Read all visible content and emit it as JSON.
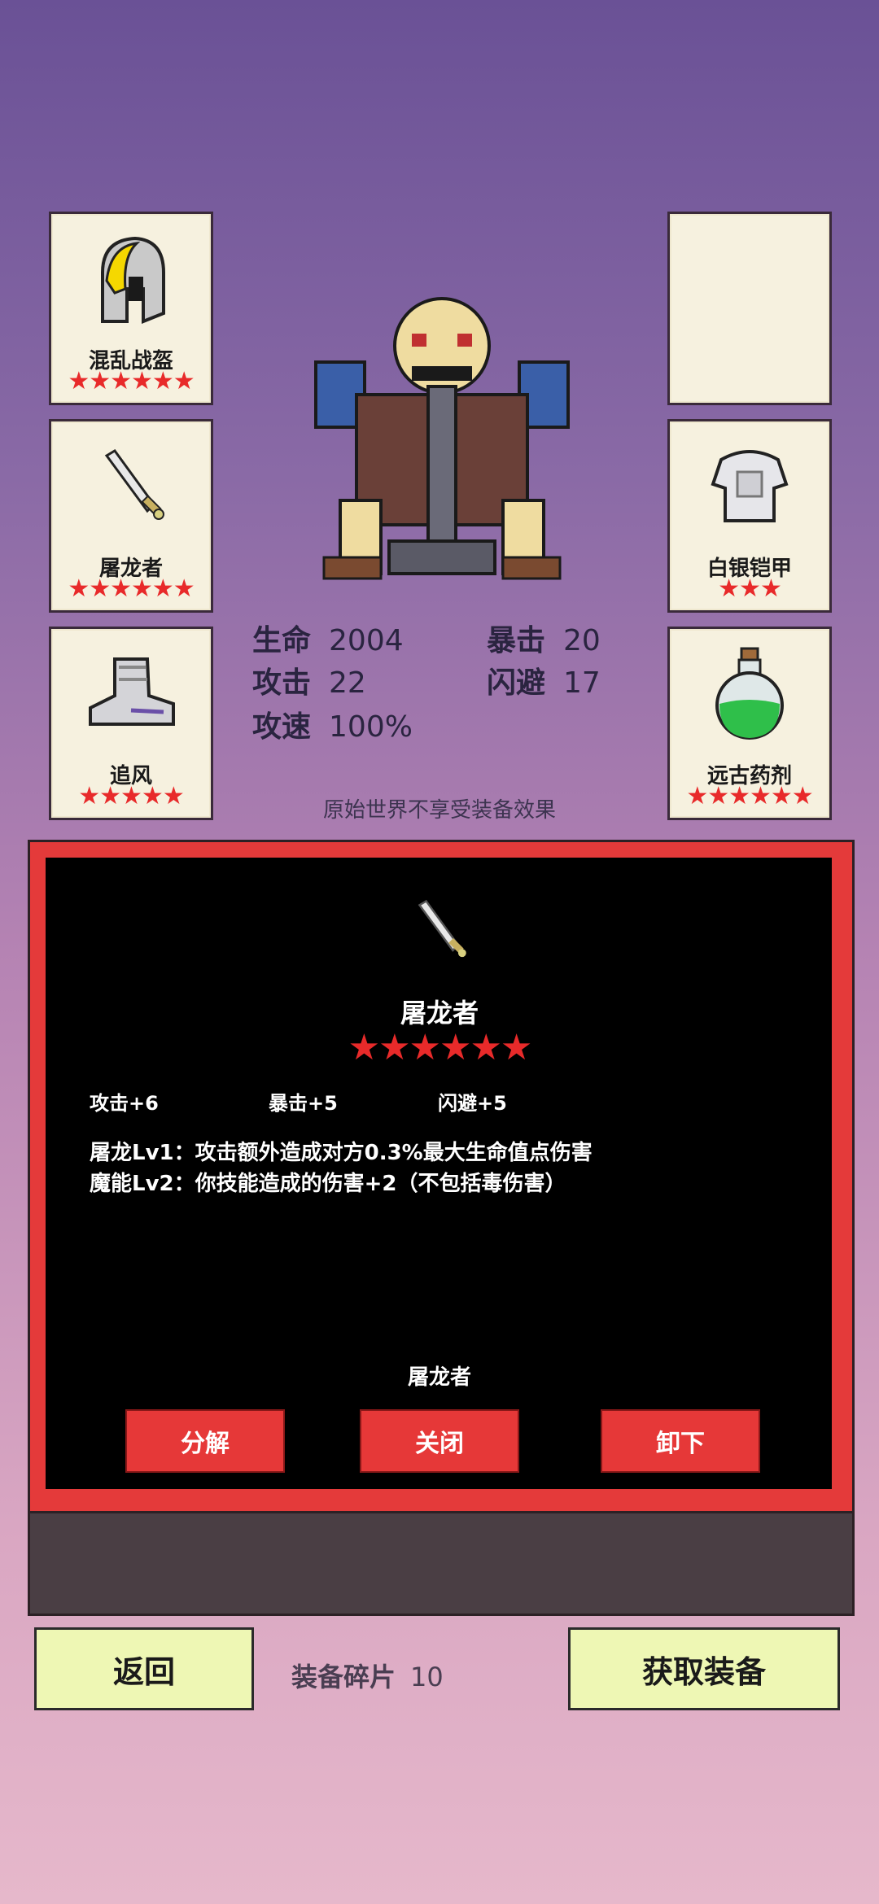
{
  "slots": {
    "helmet": {
      "name": "混乱战盔",
      "stars": "★★★★★★"
    },
    "weapon": {
      "name": "屠龙者",
      "stars": "★★★★★★"
    },
    "boots": {
      "name": "追风",
      "stars": "★★★★★"
    },
    "empty": {
      "name": "",
      "stars": ""
    },
    "armor": {
      "name": "白银铠甲",
      "stars": "★★★"
    },
    "potion": {
      "name": "远古药剂",
      "stars": "★★★★★★"
    }
  },
  "stats": {
    "hp_label": "生命",
    "hp": "2004",
    "crit_label": "暴击",
    "crit": "20",
    "atk_label": "攻击",
    "atk": "22",
    "dodge_label": "闪避",
    "dodge": "17",
    "speed_label": "攻速",
    "speed": "100%"
  },
  "note": "原始世界不享受装备效果",
  "detail": {
    "name": "屠龙者",
    "stars": "★★★★★★",
    "attrs": [
      "攻击+6",
      "暴击+5",
      "闪避+5"
    ],
    "skills": [
      "屠龙Lv1：攻击额外造成对方0.3%最大生命值点伤害",
      "魔能Lv2：你技能造成的伤害+2（不包括毒伤害）"
    ],
    "footer_name": "屠龙者",
    "buttons": {
      "decompose": "分解",
      "close": "关闭",
      "unequip": "卸下"
    }
  },
  "bottom": {
    "back": "返回",
    "shards_label": "装备碎片",
    "shards": "10",
    "get_equipment": "获取装备"
  },
  "colors": {
    "star": "#e82a2a",
    "panel_red": "#e43a3a",
    "button_yellow": "#eef7b4"
  }
}
